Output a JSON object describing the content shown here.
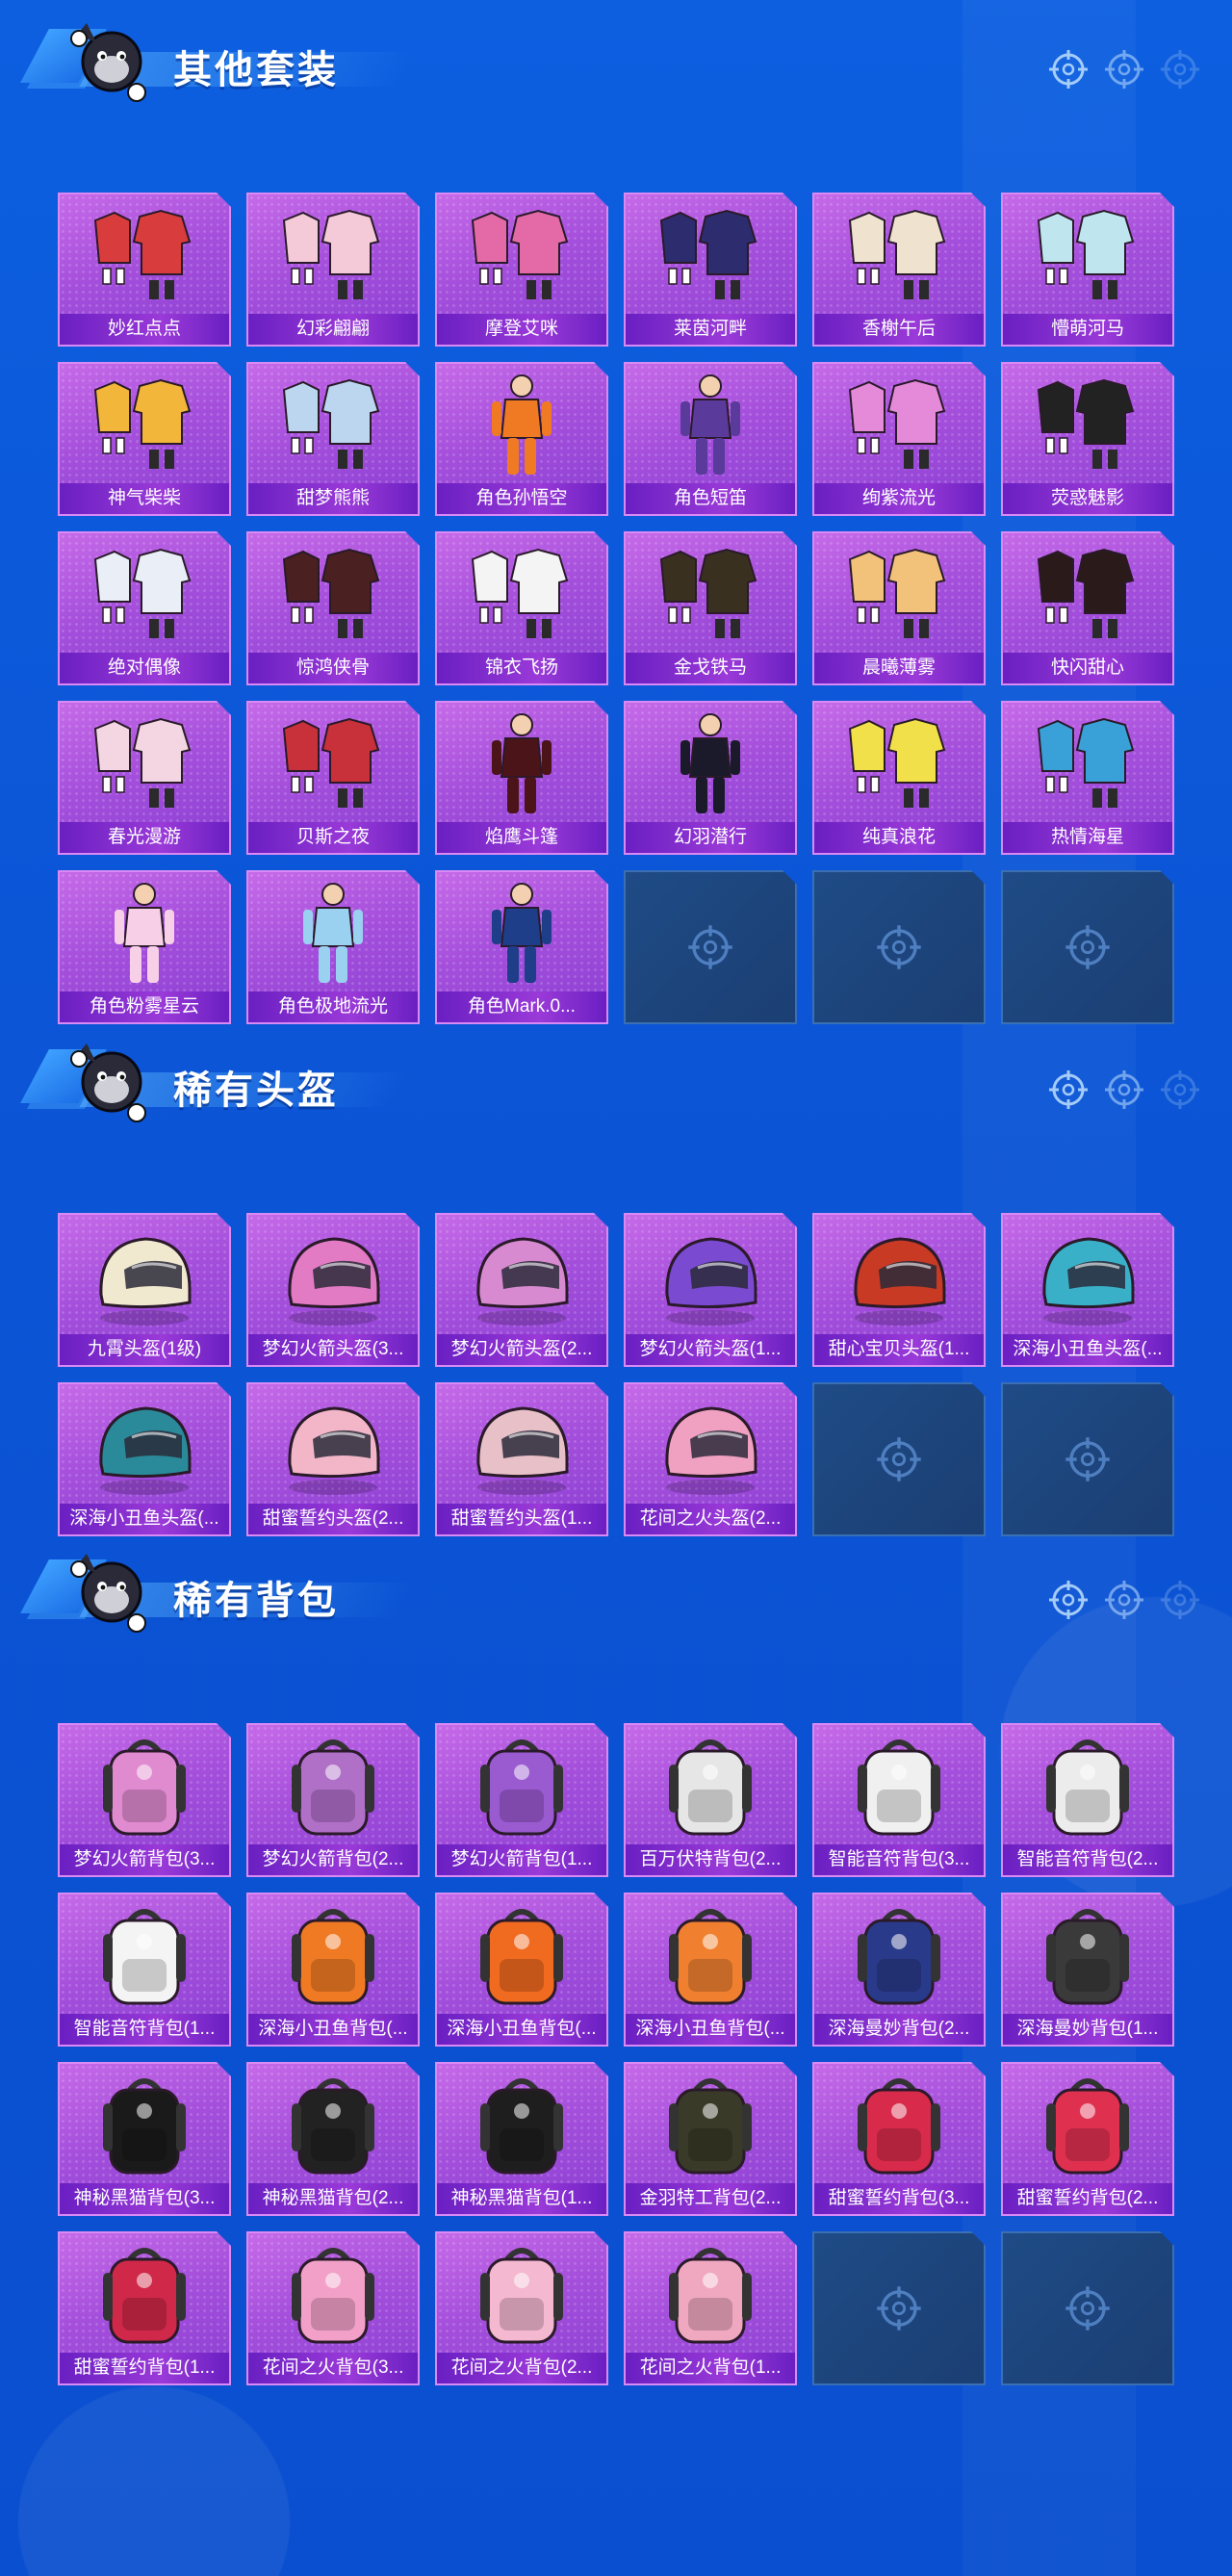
{
  "sections": [
    {
      "title": "其他套装",
      "items": [
        {
          "label": "妙红点点",
          "art": "outfit-icon",
          "tint": "#d93c3c"
        },
        {
          "label": "幻彩翩翩",
          "art": "outfit-icon",
          "tint": "#f4c9d8"
        },
        {
          "label": "摩登艾咪",
          "art": "outfit-icon",
          "tint": "#e36aa6"
        },
        {
          "label": "莱茵河畔",
          "art": "outfit-icon",
          "tint": "#2c2c6e"
        },
        {
          "label": "香榭午后",
          "art": "outfit-icon",
          "tint": "#efe3d0"
        },
        {
          "label": "懵萌河马",
          "art": "outfit-icon",
          "tint": "#bfe6ef"
        },
        {
          "label": "神气柴柴",
          "art": "outfit-icon",
          "tint": "#f1b63a"
        },
        {
          "label": "甜梦熊熊",
          "art": "outfit-icon",
          "tint": "#bcd6f0"
        },
        {
          "label": "角色孙悟空",
          "art": "character-icon",
          "tint": "#f07a24"
        },
        {
          "label": "角色短笛",
          "art": "character-icon",
          "tint": "#5a3a9a"
        },
        {
          "label": "绚紫流光",
          "art": "outfit-icon",
          "tint": "#e48ad8"
        },
        {
          "label": "荧惑魅影",
          "art": "outfit-icon",
          "tint": "#222222"
        },
        {
          "label": "绝对偶像",
          "art": "outfit-icon",
          "tint": "#e9eef7"
        },
        {
          "label": "惊鸿侠骨",
          "art": "outfit-icon",
          "tint": "#4a2020"
        },
        {
          "label": "锦衣飞扬",
          "art": "outfit-icon",
          "tint": "#f4f4f4"
        },
        {
          "label": "金戈铁马",
          "art": "outfit-icon",
          "tint": "#3a3020"
        },
        {
          "label": "晨曦薄雾",
          "art": "outfit-icon",
          "tint": "#f2c27a"
        },
        {
          "label": "快闪甜心",
          "art": "outfit-icon",
          "tint": "#2a1a1a"
        },
        {
          "label": "春光漫游",
          "art": "outfit-icon",
          "tint": "#f3d6e2"
        },
        {
          "label": "贝斯之夜",
          "art": "outfit-icon",
          "tint": "#c8303a"
        },
        {
          "label": "焰鹰斗篷",
          "art": "character-icon",
          "tint": "#4a1418"
        },
        {
          "label": "幻羽潜行",
          "art": "character-icon",
          "tint": "#1a1a2a"
        },
        {
          "label": "纯真浪花",
          "art": "outfit-icon",
          "tint": "#f2e04a"
        },
        {
          "label": "热情海星",
          "art": "outfit-icon",
          "tint": "#3aa0d8"
        },
        {
          "label": "角色粉雾星云",
          "art": "character-icon",
          "tint": "#f7d0e8"
        },
        {
          "label": "角色极地流光",
          "art": "character-icon",
          "tint": "#9ad0f0"
        },
        {
          "label": "角色Mark.0...",
          "art": "character-icon",
          "tint": "#1e3e8a"
        },
        {
          "empty": true
        },
        {
          "empty": true
        },
        {
          "empty": true
        }
      ]
    },
    {
      "title": "稀有头盔",
      "items": [
        {
          "label": "九霄头盔(1级)",
          "art": "helmet-icon",
          "tint": "#f1e8d0"
        },
        {
          "label": "梦幻火箭头盔(3...",
          "art": "helmet-icon",
          "tint": "#e27ac4"
        },
        {
          "label": "梦幻火箭头盔(2...",
          "art": "helmet-icon",
          "tint": "#d88ad0"
        },
        {
          "label": "梦幻火箭头盔(1...",
          "art": "helmet-icon",
          "tint": "#7a4ad0"
        },
        {
          "label": "甜心宝贝头盔(1...",
          "art": "helmet-icon",
          "tint": "#c83a24"
        },
        {
          "label": "深海小丑鱼头盔(...",
          "art": "helmet-icon",
          "tint": "#3ab0c8"
        },
        {
          "label": "深海小丑鱼头盔(...",
          "art": "helmet-icon",
          "tint": "#2a8a9a"
        },
        {
          "label": "甜蜜誓约头盔(2...",
          "art": "helmet-icon",
          "tint": "#f2b6c8"
        },
        {
          "label": "甜蜜誓约头盔(1...",
          "art": "helmet-icon",
          "tint": "#e8c0c8"
        },
        {
          "label": "花间之火头盔(2...",
          "art": "helmet-icon",
          "tint": "#f0a0c0"
        },
        {
          "empty": true
        },
        {
          "empty": true
        }
      ]
    },
    {
      "title": "稀有背包",
      "items": [
        {
          "label": "梦幻火箭背包(3...",
          "art": "backpack-icon",
          "tint": "#e08ad0"
        },
        {
          "label": "梦幻火箭背包(2...",
          "art": "backpack-icon",
          "tint": "#b070c8"
        },
        {
          "label": "梦幻火箭背包(1...",
          "art": "backpack-icon",
          "tint": "#9a5ad0"
        },
        {
          "label": "百万伏特背包(2...",
          "art": "backpack-icon",
          "tint": "#e6e6e6"
        },
        {
          "label": "智能音符背包(3...",
          "art": "backpack-icon",
          "tint": "#f0f0f0"
        },
        {
          "label": "智能音符背包(2...",
          "art": "backpack-icon",
          "tint": "#ececec"
        },
        {
          "label": "智能音符背包(1...",
          "art": "backpack-icon",
          "tint": "#f4f4f4"
        },
        {
          "label": "深海小丑鱼背包(...",
          "art": "backpack-icon",
          "tint": "#f07a24"
        },
        {
          "label": "深海小丑鱼背包(...",
          "art": "backpack-icon",
          "tint": "#f06a20"
        },
        {
          "label": "深海小丑鱼背包(...",
          "art": "backpack-icon",
          "tint": "#f08030"
        },
        {
          "label": "深海曼妙背包(2...",
          "art": "backpack-icon",
          "tint": "#2a3a8a"
        },
        {
          "label": "深海曼妙背包(1...",
          "art": "backpack-icon",
          "tint": "#3a3a3a"
        },
        {
          "label": "神秘黑猫背包(3...",
          "art": "backpack-icon",
          "tint": "#1a1a1a"
        },
        {
          "label": "神秘黑猫背包(2...",
          "art": "backpack-icon",
          "tint": "#222222"
        },
        {
          "label": "神秘黑猫背包(1...",
          "art": "backpack-icon",
          "tint": "#1e1e1e"
        },
        {
          "label": "金羽特工背包(2...",
          "art": "backpack-icon",
          "tint": "#3a3a28"
        },
        {
          "label": "甜蜜誓约背包(3...",
          "art": "backpack-icon",
          "tint": "#d82a4a"
        },
        {
          "label": "甜蜜誓约背包(2...",
          "art": "backpack-icon",
          "tint": "#e03050"
        },
        {
          "label": "甜蜜誓约背包(1...",
          "art": "backpack-icon",
          "tint": "#d02848"
        },
        {
          "label": "花间之火背包(3...",
          "art": "backpack-icon",
          "tint": "#f2a0c8"
        },
        {
          "label": "花间之火背包(2...",
          "art": "backpack-icon",
          "tint": "#f4b8d0"
        },
        {
          "label": "花间之火背包(1...",
          "art": "backpack-icon",
          "tint": "#f0a8c0"
        },
        {
          "empty": true
        },
        {
          "empty": true
        }
      ]
    }
  ]
}
